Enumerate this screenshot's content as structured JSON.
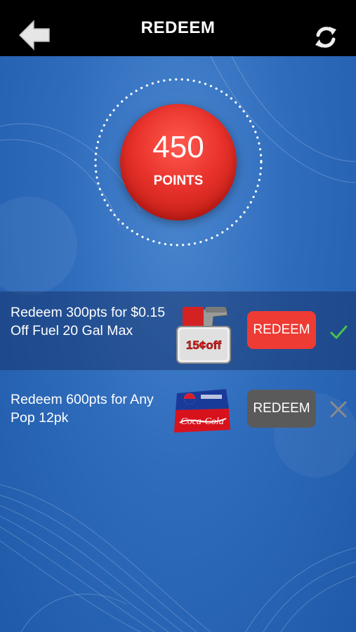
{
  "header": {
    "title": "REDEEM"
  },
  "points": {
    "value": "450",
    "label": "POINTS"
  },
  "rewards": [
    {
      "description": "Redeem 300pts for $0.15 Off Fuel 20 Gal Max",
      "badge_text": "15¢off",
      "button_label": "REDEEM",
      "button_color": "#ee3b34",
      "status": "check-icon",
      "status_color": "#4cc24a"
    },
    {
      "description": "Redeem 600pts for Any Pop 12pk",
      "badge_text": "Coca-Cola",
      "button_label": "REDEEM",
      "button_color": "#5a5a5a",
      "status": "close-icon",
      "status_color": "#8a8a8a"
    }
  ]
}
